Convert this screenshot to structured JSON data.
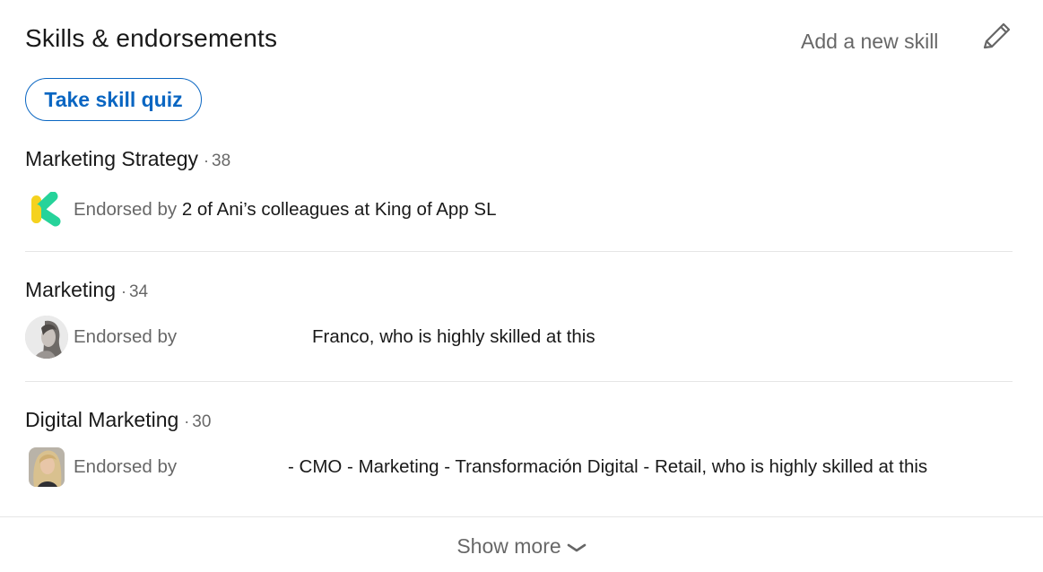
{
  "header": {
    "title": "Skills & endorsements",
    "add_skill_label": "Add a new skill",
    "edit_icon": "pencil-icon"
  },
  "quiz_button": {
    "label": "Take skill quiz"
  },
  "skills": [
    {
      "name": "Marketing Strategy",
      "separator": "·",
      "count": "38",
      "endorse_prefix": "Endorsed by",
      "endorse_detail": "2 of Ani’s colleagues at King of App SL",
      "logo_icon": "king-of-app-logo",
      "logo_colors": {
        "yellow": "#f5d21f",
        "green": "#26d39a"
      }
    },
    {
      "name": "Marketing",
      "separator": "·",
      "count": "34",
      "endorse_prefix": "Endorsed by",
      "endorse_detail": "Franco, who is highly skilled at this",
      "avatar_icon": "endorser-avatar"
    },
    {
      "name": "Digital Marketing",
      "separator": "·",
      "count": "30",
      "endorse_prefix": "Endorsed by",
      "endorse_detail": "- CMO - Marketing - Transformación Digital - Retail, who is highly skilled at this",
      "avatar_icon": "endorser-avatar"
    }
  ],
  "footer": {
    "show_more_label": "Show more",
    "chevron_icon": "chevron-down-icon"
  },
  "colors": {
    "accent": "#0a66c2",
    "divider": "#e6e6e6",
    "text_primary": "#1a1a1a",
    "text_secondary": "#666666"
  }
}
